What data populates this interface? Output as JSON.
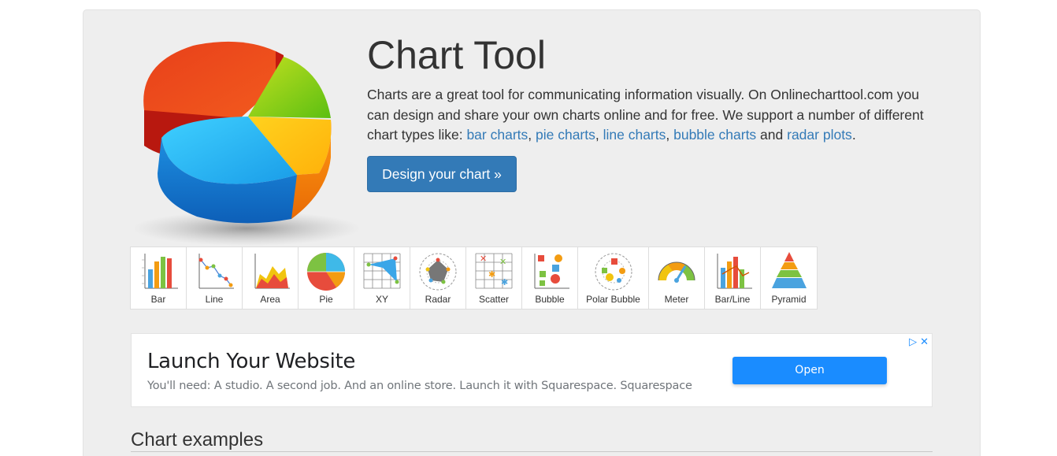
{
  "hero": {
    "title": "Chart Tool",
    "text_part1": "Charts are a great tool for communicating information visually. On Onlinecharttool.com you can design and share your own charts online and for free. We support a number of different chart types like: ",
    "links": [
      "bar charts",
      "pie charts",
      "line charts",
      "bubble charts",
      "radar plots"
    ],
    "sep1": ", ",
    "sep2": ", ",
    "sep3": ", ",
    "and": " and ",
    "end": ".",
    "button_label": "Design your chart »"
  },
  "chart_types": [
    {
      "label": "Bar",
      "icon": "bar-chart-icon"
    },
    {
      "label": "Line",
      "icon": "line-chart-icon"
    },
    {
      "label": "Area",
      "icon": "area-chart-icon"
    },
    {
      "label": "Pie",
      "icon": "pie-chart-icon"
    },
    {
      "label": "XY",
      "icon": "xy-chart-icon"
    },
    {
      "label": "Radar",
      "icon": "radar-chart-icon"
    },
    {
      "label": "Scatter",
      "icon": "scatter-chart-icon"
    },
    {
      "label": "Bubble",
      "icon": "bubble-chart-icon"
    },
    {
      "label": "Polar Bubble",
      "icon": "polar-bubble-chart-icon"
    },
    {
      "label": "Meter",
      "icon": "meter-chart-icon"
    },
    {
      "label": "Bar/Line",
      "icon": "bar-line-chart-icon"
    },
    {
      "label": "Pyramid",
      "icon": "pyramid-chart-icon"
    }
  ],
  "ad": {
    "title": "Launch Your Website",
    "description": "You'll need: A studio. A second job. And an online store. Launch it with Squarespace. Squarespace",
    "button": "Open",
    "adchoices_icon": "▷",
    "close_icon": "✕"
  },
  "examples": {
    "title": "Chart examples"
  },
  "colors": {
    "accent": "#337ab7",
    "ad_button": "#1a8cff",
    "background": "#eeeeee"
  }
}
